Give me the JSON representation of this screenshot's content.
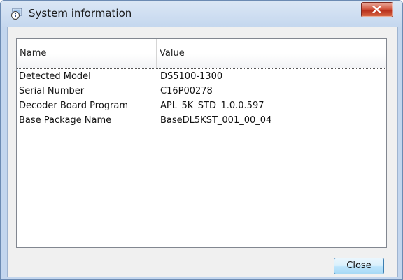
{
  "window": {
    "title": "System information"
  },
  "icons": {
    "title": "info-icon",
    "close": "close-icon"
  },
  "colors": {
    "close_button_red": "#c8462d",
    "button_blue": "#bee6fd"
  },
  "table": {
    "columns": [
      "Name",
      "Value"
    ],
    "rows": [
      {
        "name": "Detected Model",
        "value": "DS5100-1300"
      },
      {
        "name": "Serial Number",
        "value": "C16P00278"
      },
      {
        "name": "Decoder Board Program",
        "value": "APL_5K_STD_1.0.0.597"
      },
      {
        "name": "Base Package Name",
        "value": "BaseDL5KST_001_00_04"
      }
    ]
  },
  "buttons": {
    "close_label": "Close"
  }
}
